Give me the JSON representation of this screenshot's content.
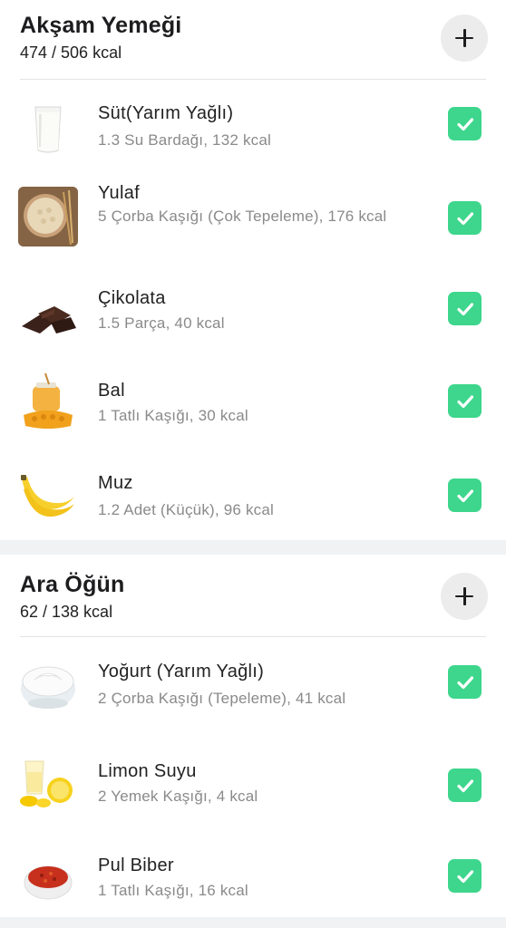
{
  "sections": [
    {
      "title": "Akşam Yemeği",
      "kcal": "474 / 506 kcal",
      "items": [
        {
          "name": "Süt(Yarım Yağlı)",
          "detail": "1.3 Su Bardağı, 132 kcal",
          "icon": "milk-glass-icon"
        },
        {
          "name": "Yulaf",
          "detail": "5 Çorba Kaşığı (Çok Tepeleme), 176 kcal",
          "icon": "oats-bowl-icon"
        },
        {
          "name": "Çikolata",
          "detail": "1.5 Parça, 40 kcal",
          "icon": "chocolate-icon"
        },
        {
          "name": "Bal",
          "detail": "1 Tatlı Kaşığı, 30 kcal",
          "icon": "honey-icon"
        },
        {
          "name": "Muz",
          "detail": "1.2 Adet (Küçük), 96 kcal",
          "icon": "banana-icon"
        }
      ]
    },
    {
      "title": "Ara Öğün",
      "kcal": "62 / 138 kcal",
      "items": [
        {
          "name": "Yoğurt (Yarım Yağlı)",
          "detail": "2 Çorba Kaşığı (Tepeleme), 41 kcal",
          "icon": "yogurt-bowl-icon"
        },
        {
          "name": "Limon Suyu",
          "detail": "2 Yemek Kaşığı, 4 kcal",
          "icon": "lemon-juice-icon"
        },
        {
          "name": "Pul Biber",
          "detail": "1 Tatlı Kaşığı, 16 kcal",
          "icon": "chili-flakes-icon"
        }
      ]
    }
  ],
  "colors": {
    "check": "#3dd68c",
    "add_button_bg": "#ececec",
    "detail_text": "#8a8a8a"
  }
}
